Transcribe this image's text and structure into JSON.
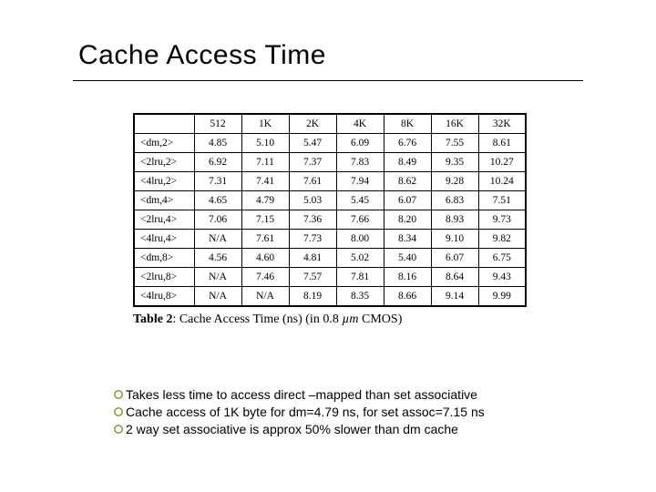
{
  "title": "Cache Access Time",
  "chart_data": {
    "type": "table",
    "title": "Cache Access Time (ns)  (in 0.8 µm CMOS)",
    "columns": [
      "",
      "512",
      "1K",
      "2K",
      "4K",
      "8K",
      "16K",
      "32K"
    ],
    "rows": [
      {
        "label": "<dm,2>",
        "values": [
          "4.85",
          "5.10",
          "5.47",
          "6.09",
          "6.76",
          "7.55",
          "8.61"
        ]
      },
      {
        "label": "<2lru,2>",
        "values": [
          "6.92",
          "7.11",
          "7.37",
          "7.83",
          "8.49",
          "9.35",
          "10.27"
        ]
      },
      {
        "label": "<4lru,2>",
        "values": [
          "7.31",
          "7.41",
          "7.61",
          "7.94",
          "8.62",
          "9.28",
          "10.24"
        ]
      },
      {
        "label": "<dm,4>",
        "values": [
          "4.65",
          "4.79",
          "5.03",
          "5.45",
          "6.07",
          "6.83",
          "7.51"
        ]
      },
      {
        "label": "<2lru,4>",
        "values": [
          "7.06",
          "7.15",
          "7.36",
          "7.66",
          "8.20",
          "8.93",
          "9.73"
        ]
      },
      {
        "label": "<4lru,4>",
        "values": [
          "N/A",
          "7.61",
          "7.73",
          "8.00",
          "8.34",
          "9.10",
          "9.82"
        ]
      },
      {
        "label": "<dm,8>",
        "values": [
          "4.56",
          "4.60",
          "4.81",
          "5.02",
          "5.40",
          "6.07",
          "6.75"
        ]
      },
      {
        "label": "<2lru,8>",
        "values": [
          "N/A",
          "7.46",
          "7.57",
          "7.81",
          "8.16",
          "8.64",
          "9.43"
        ]
      },
      {
        "label": "<4lru,8>",
        "values": [
          "N/A",
          "N/A",
          "8.19",
          "8.35",
          "8.66",
          "9.14",
          "9.99"
        ]
      }
    ]
  },
  "caption": {
    "lead": "Table 2",
    "rest": ": Cache Access Time (ns)  (in 0.8 ",
    "unit": "µm",
    "tail": " CMOS)"
  },
  "bullets": [
    "Takes less time to access direct –mapped than set associative",
    "Cache access of 1K byte for dm=4.79 ns, for set assoc=7.15 ns",
    "2 way set associative is approx 50% slower than dm cache"
  ]
}
